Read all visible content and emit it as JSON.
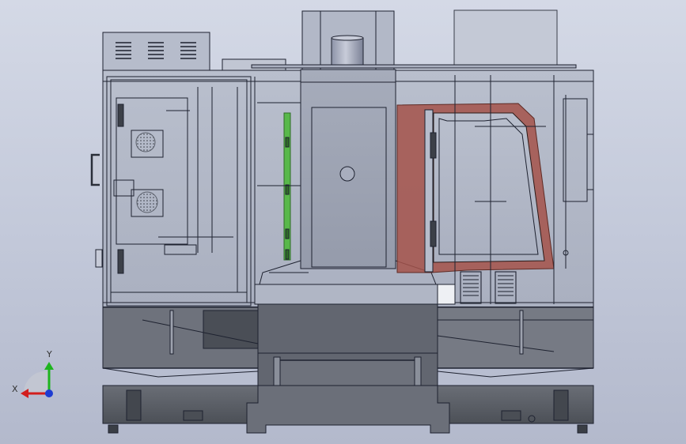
{
  "triad": {
    "x_label": "X",
    "y_label": "Y"
  },
  "colors": {
    "background_top": "#d4d9e6",
    "background_bottom": "#b3b9cc",
    "machine_body": "#b4bac8",
    "line": "#1e2230",
    "enclosure_dark": "#4f535b",
    "base_dark": "#5b5f66",
    "spindle_head": "#9ea4b4",
    "pallet_frame_red": "#a4524a",
    "coolant_hose_green": "#58b84a",
    "axis_x": "#d21e1e",
    "axis_y": "#1eb41e",
    "axis_z": "#1e3cd2"
  }
}
